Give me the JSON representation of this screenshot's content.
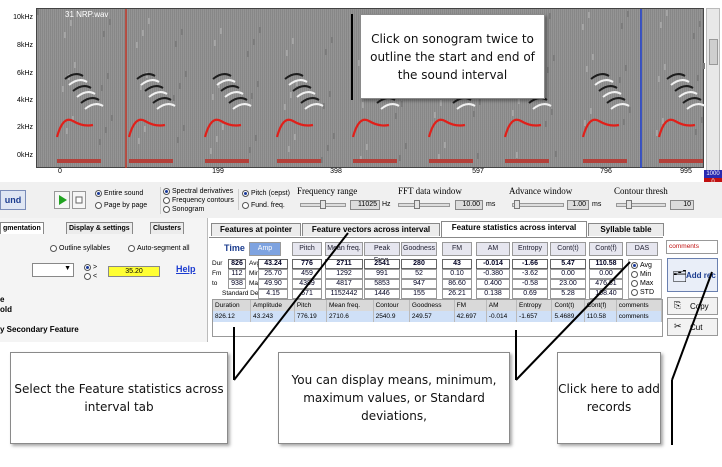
{
  "file_name": "31 NRP.wav",
  "sonogram": {
    "y_ticks": [
      "10kHz",
      "8kHz",
      "6kHz",
      "4kHz",
      "2kHz",
      "0kHz"
    ],
    "x_ticks": [
      "0",
      "199",
      "398",
      "597",
      "796",
      "995"
    ],
    "side_values": [
      "1000",
      "0"
    ],
    "colors": {
      "contour": "#e0201a",
      "start_marker": "#c0392b",
      "end_marker": "#1f3fd1",
      "band": "#b3403a"
    }
  },
  "controls": {
    "play_label": "und",
    "sound_mode": {
      "options": [
        "Entire sound",
        "Page by page"
      ],
      "selected": "Entire sound"
    },
    "display_mode": {
      "options": [
        "Spectral derivatives",
        "Frequency contours",
        "Sonogram"
      ],
      "selected": "Spectral derivatives"
    },
    "pitch_mode": {
      "options": [
        "Pitch (cepst)",
        "Fund. freq."
      ],
      "selected": "Pitch (cepst)"
    },
    "frequency_range": {
      "label": "Frequency range",
      "value": "11025",
      "unit": "Hz"
    },
    "fft_window": {
      "label": "FFT data window",
      "value": "10.00",
      "unit": "ms"
    },
    "advance_window": {
      "label": "Advance window",
      "value": "1.00",
      "unit": "ms"
    },
    "contour_thresh": {
      "label": "Contour thresh",
      "value": "10"
    }
  },
  "left_panel": {
    "tabs": [
      "gmentation",
      "Display & settings",
      "Clusters"
    ],
    "outline_syllables": "Outline syllables",
    "auto_segment_all": "Auto-segment all",
    "threshold_value": "35.20",
    "help_link": "Help",
    "side_labels": [
      "e",
      "old"
    ],
    "secondary_feature": "y Secondary Feature"
  },
  "tabs": [
    "Features at pointer",
    "Feature vectors across interval",
    "Feature statistics across interval",
    "Syllable table"
  ],
  "active_tab": "Feature statistics across interval",
  "stats": {
    "time_label": "Time",
    "columns": [
      "Amp",
      "Pitch",
      "Mean freq.",
      "Peak Freq.",
      "Goodness",
      "FM",
      "AM",
      "Entropy",
      "Cont(t)",
      "Cont(f)",
      "DAS"
    ],
    "row_labels": [
      "Dur",
      "Fm",
      "to",
      "Standard Dev"
    ],
    "stat_labels": [
      "Avg",
      "Min",
      "Max"
    ],
    "time_values": [
      "826",
      "112",
      "938"
    ],
    "avg": [
      "43.24",
      "776",
      "2711",
      "2541",
      "280",
      "43",
      "-0.014",
      "-1.66",
      "5.47",
      "110.58"
    ],
    "min": [
      "25.70",
      "459",
      "1292",
      "991",
      "52",
      "0.10",
      "-0.380",
      "-3.62",
      "0.00",
      "0.00"
    ],
    "max": [
      "49.90",
      "4389",
      "4817",
      "5853",
      "947",
      "86.60",
      "0.400",
      "-0.58",
      "23.00",
      "476.81"
    ],
    "std": [
      "4.15",
      "671",
      "1152442",
      "1446",
      "155",
      "26.21",
      "0.138",
      "0.69",
      "5.28",
      "108.40"
    ],
    "display_options": [
      "Avg",
      "Min",
      "Max",
      "STD"
    ],
    "display_selected": "Avg",
    "comments_label": "comments"
  },
  "records": {
    "headers": [
      "Duration",
      "Amplitude",
      "Pitch",
      "Mean freq.",
      "Contour",
      "Goodness",
      "FM",
      "AM",
      "Entropy",
      "Cont(t)",
      "Cont(f)",
      "comments"
    ],
    "rows": [
      [
        "826.12",
        "43.243",
        "776.19",
        "2710.6",
        "2540.9",
        "249.57",
        "42.697",
        "-0.014",
        "-1.657",
        "5.4689",
        "110.58",
        "comments"
      ]
    ]
  },
  "buttons": {
    "add_rec": "Add rec",
    "copy": "Copy",
    "cut": "Cut"
  },
  "callouts": {
    "top": "Click on sonogram twice to outline the start and end of the sound interval",
    "bottom_left": "Select the Feature statistics across interval tab",
    "bottom_middle": "You can display means, minimum, maximum values, or Standard deviations,",
    "bottom_right": "Click here to add records"
  }
}
